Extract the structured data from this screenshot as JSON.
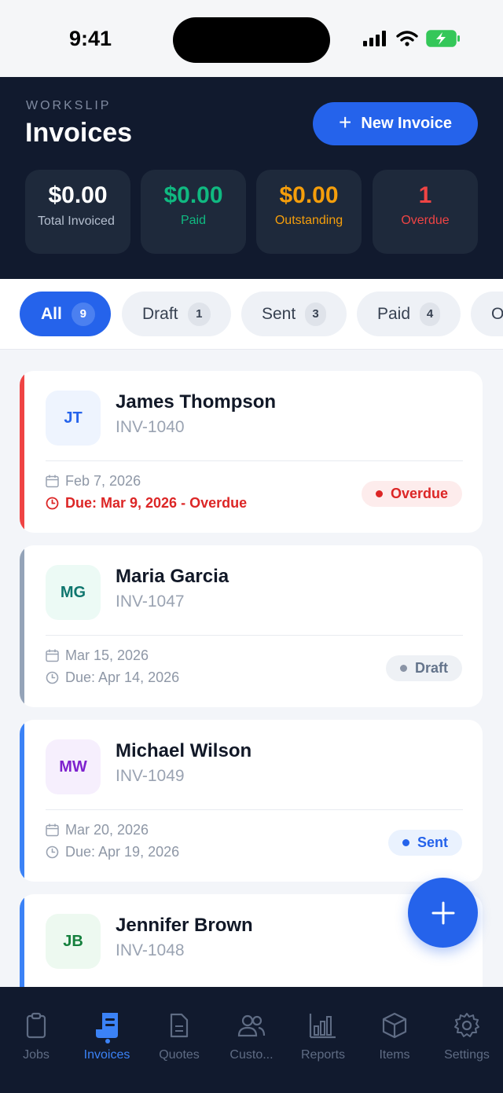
{
  "status_bar": {
    "time": "9:41"
  },
  "header": {
    "brand": "WORKSLIP",
    "title": "Invoices",
    "new_button": "New Invoice"
  },
  "stats": [
    {
      "value": "$0.00",
      "label": "Total Invoiced",
      "color": "#ffffff"
    },
    {
      "value": "$0.00",
      "label": "Paid",
      "color": "#10b981"
    },
    {
      "value": "$0.00",
      "label": "Outstanding",
      "color": "#f59e0b"
    },
    {
      "value": "1",
      "label": "Overdue",
      "color": "#ef4444"
    }
  ],
  "filters": [
    {
      "label": "All",
      "count": "9",
      "active": true
    },
    {
      "label": "Draft",
      "count": "1"
    },
    {
      "label": "Sent",
      "count": "3"
    },
    {
      "label": "Paid",
      "count": "4"
    },
    {
      "label": "O",
      "count": ""
    }
  ],
  "invoices": [
    {
      "initials": "JT",
      "name": "James Thompson",
      "number": "INV-1040",
      "date": "Feb 7, 2026",
      "due": "Due: Mar 9, 2026 - Overdue",
      "status": "Overdue",
      "accent": "#ef4444"
    },
    {
      "initials": "MG",
      "name": "Maria Garcia",
      "number": "INV-1047",
      "date": "Mar 15, 2026",
      "due": "Due: Apr 14, 2026",
      "status": "Draft",
      "accent": "#94a3b8"
    },
    {
      "initials": "MW",
      "name": "Michael Wilson",
      "number": "INV-1049",
      "date": "Mar 20, 2026",
      "due": "Due: Apr 19, 2026",
      "status": "Sent",
      "accent": "#3b82f6"
    },
    {
      "initials": "JB",
      "name": "Jennifer Brown",
      "number": "INV-1048",
      "accent": "#3b82f6"
    }
  ],
  "bottom_nav": [
    {
      "label": "Jobs",
      "icon": "clipboard-icon"
    },
    {
      "label": "Invoices",
      "icon": "receipt-icon",
      "active": true
    },
    {
      "label": "Quotes",
      "icon": "document-icon"
    },
    {
      "label": "Custo...",
      "icon": "users-icon"
    },
    {
      "label": "Reports",
      "icon": "bar-chart-icon"
    },
    {
      "label": "Items",
      "icon": "box-icon"
    },
    {
      "label": "Settings",
      "icon": "gear-icon"
    }
  ]
}
